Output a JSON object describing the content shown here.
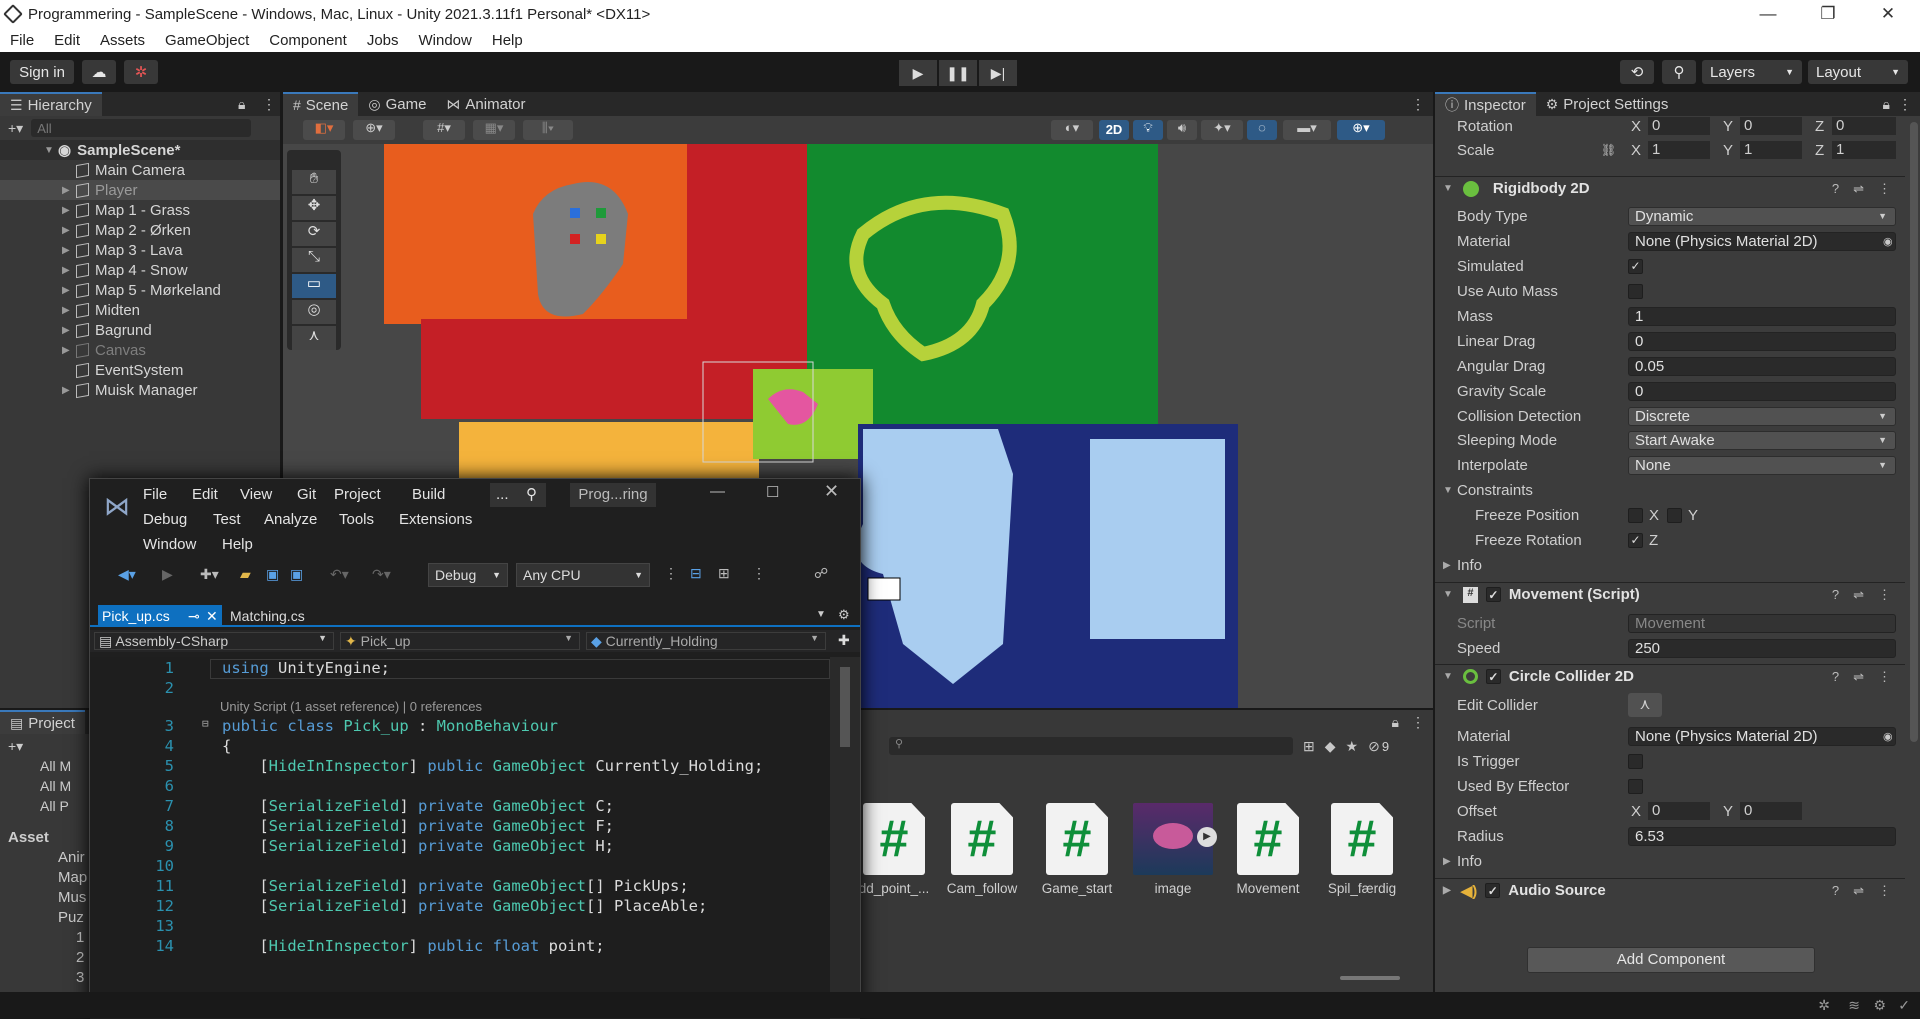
{
  "window": {
    "title": "Programmering - SampleScene - Windows, Mac, Linux - Unity 2021.3.11f1 Personal* <DX11>"
  },
  "menu": [
    "File",
    "Edit",
    "Assets",
    "GameObject",
    "Component",
    "Jobs",
    "Window",
    "Help"
  ],
  "toolbar": {
    "sign_in": "Sign in",
    "layers": "Layers",
    "layout": "Layout"
  },
  "hierarchy": {
    "tab": "Hierarchy",
    "search_placeholder": "All",
    "scene": "SampleScene*",
    "items": [
      "Main Camera",
      "Player",
      "Map 1 -  Grass",
      "Map 2 - Ørken",
      "Map 3 - Lava",
      "Map 4 - Snow",
      "Map 5 - Mørkeland",
      "Midten",
      "Bagrund",
      "Canvas",
      "EventSystem",
      "Muisk Manager"
    ]
  },
  "scene_tabs": [
    "Scene",
    "Game",
    "Animator"
  ],
  "scene_toolbar": {
    "mode_2d": "2D"
  },
  "project": {
    "tab": "Project",
    "tree": [
      "All M",
      "All M",
      "All P",
      "Asset",
      "Anir",
      "Map",
      "Mus",
      "Puz",
      "1",
      "2",
      "3"
    ],
    "asset_count": "9",
    "assets": [
      {
        "name": "dd_point_...",
        "kind": "script"
      },
      {
        "name": "Cam_follow",
        "kind": "script"
      },
      {
        "name": "Game_start",
        "kind": "script"
      },
      {
        "name": "image",
        "kind": "image"
      },
      {
        "name": "Movement",
        "kind": "script"
      },
      {
        "name": "Spil_færdig",
        "kind": "script"
      }
    ]
  },
  "inspector": {
    "tabs": [
      "Inspector",
      "Project Settings"
    ],
    "transform": {
      "rotation_label": "Rotation",
      "rotation": {
        "x": "0",
        "y": "0",
        "z": "0"
      },
      "scale_label": "Scale",
      "scale": {
        "x": "1",
        "y": "1",
        "z": "1"
      }
    },
    "rigidbody": {
      "title": "Rigidbody 2D",
      "body_type_label": "Body Type",
      "body_type": "Dynamic",
      "material_label": "Material",
      "material": "None (Physics Material 2D)",
      "simulated_label": "Simulated",
      "simulated": true,
      "auto_mass_label": "Use Auto Mass",
      "auto_mass": false,
      "mass_label": "Mass",
      "mass": "1",
      "linear_drag_label": "Linear Drag",
      "linear_drag": "0",
      "angular_drag_label": "Angular Drag",
      "angular_drag": "0.05",
      "gravity_label": "Gravity Scale",
      "gravity": "0",
      "collision_label": "Collision Detection",
      "collision": "Discrete",
      "sleeping_label": "Sleeping Mode",
      "sleeping": "Start Awake",
      "interpolate_label": "Interpolate",
      "interpolate": "None",
      "constraints_label": "Constraints",
      "freeze_pos_label": "Freeze Position",
      "freeze_rot_label": "Freeze Rotation",
      "info_label": "Info",
      "x": "X",
      "y": "Y",
      "z": "Z"
    },
    "movement": {
      "title": "Movement (Script)",
      "script_label": "Script",
      "script": "Movement",
      "speed_label": "Speed",
      "speed": "250"
    },
    "circle": {
      "title": "Circle Collider 2D",
      "edit_label": "Edit Collider",
      "material_label": "Material",
      "material": "None (Physics Material 2D)",
      "trigger_label": "Is Trigger",
      "effector_label": "Used By Effector",
      "offset_label": "Offset",
      "offset": {
        "x": "0",
        "y": "0"
      },
      "radius_label": "Radius",
      "radius": "6.53",
      "info_label": "Info"
    },
    "audio": {
      "title": "Audio Source"
    },
    "add_component": "Add Component"
  },
  "vs": {
    "menu_row1": [
      "File",
      "Edit",
      "View",
      "Git",
      "Project",
      "Build"
    ],
    "menu_row2": [
      "Debug",
      "Test",
      "Analyze",
      "Tools",
      "Extensions"
    ],
    "menu_row3": [
      "Window",
      "Help"
    ],
    "search": "...",
    "solution": "Prog...ring",
    "config": "Debug",
    "platform": "Any CPU",
    "tabs": [
      "Pick_up.cs",
      "Matching.cs"
    ],
    "nav": {
      "project": "Assembly-CSharp",
      "class": "Pick_up",
      "member": "Currently_Holding"
    },
    "codelens": "Unity Script (1 asset reference) | 0 references",
    "lines": [
      {
        "n": "1",
        "t": "using UnityEngine;"
      },
      {
        "n": "2",
        "t": ""
      },
      {
        "n": "3",
        "t": "public class Pick_up : MonoBehaviour"
      },
      {
        "n": "4",
        "t": "{"
      },
      {
        "n": "5",
        "t": "    [HideInInspector] public GameObject Currently_Holding;"
      },
      {
        "n": "6",
        "t": ""
      },
      {
        "n": "7",
        "t": "    [SerializeField] private GameObject C;"
      },
      {
        "n": "8",
        "t": "    [SerializeField] private GameObject F;"
      },
      {
        "n": "9",
        "t": "    [SerializeField] private GameObject H;"
      },
      {
        "n": "10",
        "t": ""
      },
      {
        "n": "11",
        "t": "    [SerializeField] private GameObject[] PickUps;"
      },
      {
        "n": "12",
        "t": "    [SerializeField] private GameObject[] PlaceAble;"
      },
      {
        "n": "13",
        "t": ""
      },
      {
        "n": "14",
        "t": "    [HideInInspector] public float point;"
      }
    ]
  },
  "colors": {
    "accent": "#3a79bb",
    "unity_dark": "#383838",
    "vs_bg": "#1e1e1e",
    "csharp_green": "#0f8f3a"
  }
}
